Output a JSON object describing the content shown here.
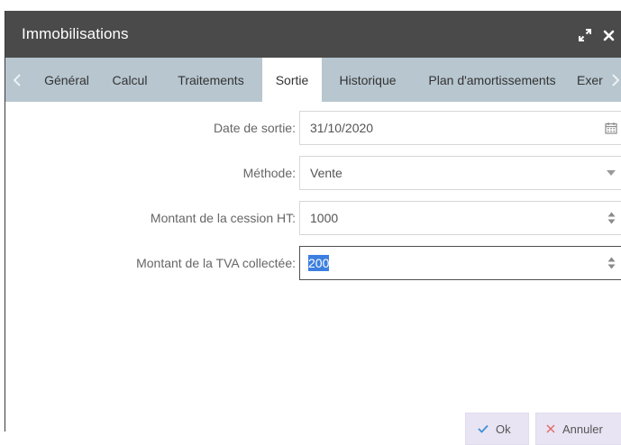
{
  "window": {
    "title": "Immobilisations",
    "maximize_icon": "expand-icon",
    "close_icon": "close-icon"
  },
  "tabs": [
    {
      "label": "Général",
      "active": false
    },
    {
      "label": "Calcul",
      "active": false
    },
    {
      "label": "Traitements",
      "active": false
    },
    {
      "label": "Sortie",
      "active": true
    },
    {
      "label": "Historique",
      "active": false
    },
    {
      "label": "Plan d'amortissements",
      "active": false
    },
    {
      "label": "Exer",
      "active": false
    }
  ],
  "form": {
    "date_sortie": {
      "label": "Date de sortie:",
      "value": "31/10/2020",
      "icon": "calendar-icon"
    },
    "methode": {
      "label": "Méthode:",
      "value": "Vente",
      "icon": "chevron-down-icon"
    },
    "montant_cession": {
      "label": "Montant de la cession HT:",
      "value": "1000",
      "icon": "spinner-icon"
    },
    "montant_tva": {
      "label": "Montant de la TVA collectée:",
      "value": "200",
      "icon": "spinner-icon",
      "selected": true
    }
  },
  "buttons": {
    "ok": {
      "label": "Ok",
      "icon": "check-icon"
    },
    "cancel": {
      "label": "Annuler",
      "icon": "x-icon"
    }
  },
  "colors": {
    "titlebar": "#4a4a4a",
    "tabbar": "#b7c6cf",
    "selection": "#3d7fe0",
    "ok_check": "#3d8fd6",
    "cancel_x": "#e46b6b"
  }
}
